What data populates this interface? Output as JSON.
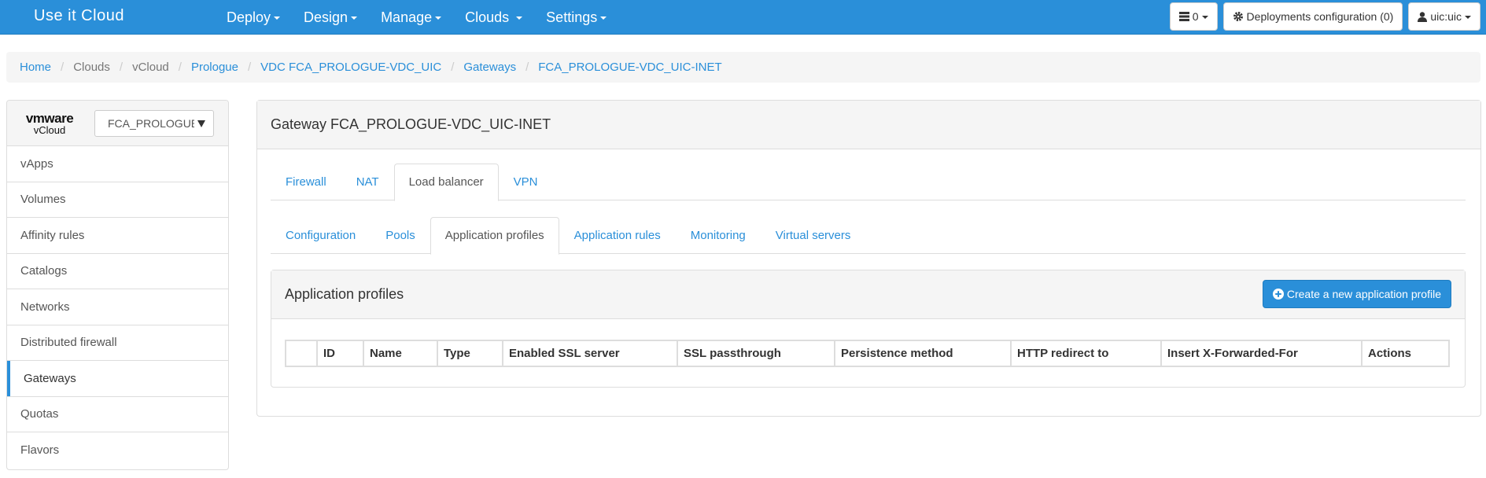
{
  "navbar": {
    "brand": "Use it Cloud",
    "menu": [
      "Deploy",
      "Design",
      "Manage",
      "Clouds",
      "Settings"
    ],
    "tasks_count": "0",
    "deployments_config": "Deployments configuration (0)",
    "user": "uic:uic"
  },
  "breadcrumb": [
    "Home",
    "Clouds",
    "vCloud",
    "Prologue",
    "VDC FCA_PROLOGUE-VDC_UIC",
    "Gateways",
    "FCA_PROLOGUE-VDC_UIC-INET"
  ],
  "sidebar": {
    "logo_line1": "vmware",
    "logo_line2": "vCloud",
    "select_value": "FCA_PROLOGUE",
    "items": [
      "vApps",
      "Volumes",
      "Affinity rules",
      "Catalogs",
      "Networks",
      "Distributed firewall",
      "Gateways",
      "Quotas",
      "Flavors"
    ],
    "active": "Gateways"
  },
  "main": {
    "title": "Gateway FCA_PROLOGUE-VDC_UIC-INET",
    "tabs": [
      "Firewall",
      "NAT",
      "Load balancer",
      "VPN"
    ],
    "active_tab": "Load balancer",
    "subtabs": [
      "Configuration",
      "Pools",
      "Application profiles",
      "Application rules",
      "Monitoring",
      "Virtual servers"
    ],
    "active_subtab": "Application profiles",
    "section_title": "Application profiles",
    "create_button": "Create a new application profile",
    "table_headers": [
      "",
      "ID",
      "Name",
      "Type",
      "Enabled SSL server",
      "SSL passthrough",
      "Persistence method",
      "HTTP redirect to",
      "Insert X-Forwarded-For",
      "Actions"
    ]
  },
  "colors": {
    "accent": "#2a8fd9",
    "navbar": "#2a8fd9"
  }
}
